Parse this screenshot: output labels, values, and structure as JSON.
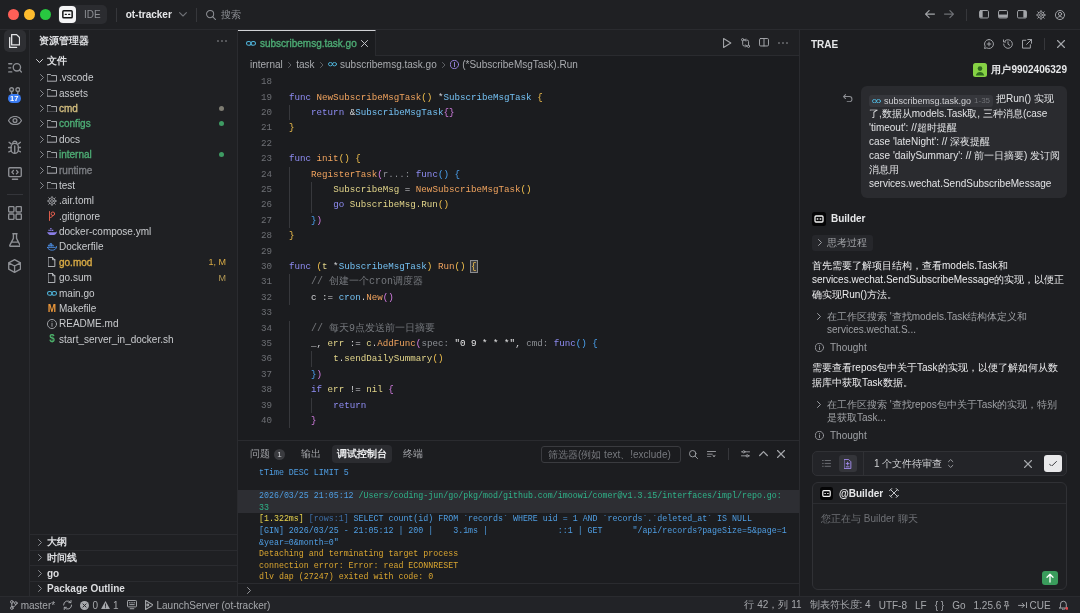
{
  "title_bar": {
    "mode_switch": [
      {
        "kind": "logo",
        "selected": true
      },
      {
        "kind": "label",
        "label": "IDE",
        "selected": false
      }
    ],
    "project": "ot-tracker",
    "search": {
      "placeholder": "搜索"
    }
  },
  "activity_bar": {
    "groups": [
      {
        "items": [
          {
            "kind": "explorer",
            "selected": true
          },
          {
            "kind": "search",
            "selected": false
          },
          {
            "kind": "source_control",
            "selected": false,
            "badge": "17"
          },
          {
            "kind": "preview",
            "selected": false
          },
          {
            "kind": "debug",
            "selected": false
          },
          {
            "kind": "remote",
            "selected": false
          }
        ]
      },
      {
        "items": [
          {
            "kind": "extensions",
            "selected": false
          },
          {
            "kind": "testing",
            "selected": false
          },
          {
            "kind": "packages",
            "selected": false
          }
        ]
      }
    ]
  },
  "sidebar": {
    "title": "资源管理器",
    "section": {
      "label": "文件",
      "expanded": true,
      "items": [
        {
          "label": ".vscode",
          "kind": "folder",
          "expanded": false
        },
        {
          "label": "assets",
          "kind": "folder",
          "expanded": false
        },
        {
          "label": "cmd",
          "kind": "folder",
          "expanded": false,
          "color": "#d2bd7e",
          "dot": {
            "color": "#7e7c72"
          }
        },
        {
          "label": "configs",
          "kind": "folder",
          "expanded": false,
          "color": "#4dab74",
          "dot": {
            "color": "#3e9b63"
          }
        },
        {
          "label": "docs",
          "kind": "folder",
          "expanded": false
        },
        {
          "label": "internal",
          "kind": "folder",
          "expanded": false,
          "color": "#4dab74",
          "dot": {
            "color": "#3e9b63"
          }
        },
        {
          "label": "runtime",
          "kind": "folder",
          "expanded": false,
          "color": "#7c7e83"
        },
        {
          "label": "test",
          "kind": "folder",
          "expanded": false
        },
        {
          "label": ".air.toml",
          "kind": "toml"
        },
        {
          "label": ".gitignore",
          "kind": "gitignore"
        },
        {
          "label": "docker-compose.yml",
          "kind": "compose"
        },
        {
          "label": "Dockerfile",
          "kind": "dockerfile"
        },
        {
          "label": "go.mod",
          "kind": "text",
          "color": "#d9ab45",
          "badge": "1, M"
        },
        {
          "label": "go.sum",
          "kind": "text",
          "badge": "M"
        },
        {
          "label": "main.go",
          "kind": "go"
        },
        {
          "label": "Makefile",
          "kind": "makefile",
          "glyph": "M"
        },
        {
          "label": "README.md",
          "kind": "markdown"
        },
        {
          "label": "start_server_in_docker.sh",
          "kind": "shell",
          "glyph": "$"
        }
      ]
    },
    "panels": [
      {
        "label": "大纲",
        "expanded": false
      },
      {
        "label": "时间线",
        "expanded": false
      },
      {
        "label": "go",
        "expanded": false
      },
      {
        "label": "Package Outline",
        "expanded": false
      }
    ]
  },
  "editor": {
    "tabs": [
      {
        "label": "subscribemsg.task.go",
        "selected": true,
        "color": "#4dab74"
      }
    ],
    "breadcrumb": [
      {
        "label": "internal",
        "kind": "folder"
      },
      {
        "label": "task",
        "kind": "folder"
      },
      {
        "label": "subscribemsg.task.go",
        "kind": "go"
      },
      {
        "label": "(*SubscribeMsgTask).Run",
        "kind": "method"
      }
    ],
    "lines": [
      {
        "number": "18"
      },
      {
        "number": "19",
        "tokens": [
          {
            "text": "func",
            "kind": "keyword"
          },
          {
            "text": " NewSubscribeMsgTask",
            "kind": "function"
          },
          {
            "text": "()",
            "kind": "bracket1"
          },
          {
            "text": " *",
            "kind": "plain"
          },
          {
            "text": "SubscribeMsgTask",
            "kind": "type"
          },
          {
            "text": " {",
            "kind": "bracket1"
          }
        ]
      },
      {
        "number": "20",
        "tokens": [
          {
            "text": "    return",
            "kind": "keyword"
          },
          {
            "text": " &",
            "kind": "plain"
          },
          {
            "text": "SubscribeMsgTask",
            "kind": "type"
          },
          {
            "text": "{}",
            "kind": "bracket2"
          }
        ]
      },
      {
        "number": "21",
        "tokens": [
          {
            "text": "}",
            "kind": "bracket1"
          }
        ]
      },
      {
        "number": "22"
      },
      {
        "number": "23",
        "tokens": [
          {
            "text": "func",
            "kind": "keyword"
          },
          {
            "text": " init",
            "kind": "function"
          },
          {
            "text": "()",
            "kind": "bracket1"
          },
          {
            "text": " {",
            "kind": "bracket1"
          }
        ]
      },
      {
        "number": "24",
        "tokens": [
          {
            "text": "    RegisterTask",
            "kind": "function"
          },
          {
            "text": "(",
            "kind": "bracket2"
          },
          {
            "text": "r...:",
            "kind": "hint"
          },
          {
            "text": " func",
            "kind": "keyword"
          },
          {
            "text": "()",
            "kind": "bracket3"
          },
          {
            "text": " {",
            "kind": "bracket3"
          }
        ]
      },
      {
        "number": "25",
        "tokens": [
          {
            "text": "        SubscribeMsg",
            "kind": "variable"
          },
          {
            "text": " = ",
            "kind": "plain"
          },
          {
            "text": "NewSubscribeMsgTask",
            "kind": "function"
          },
          {
            "text": "()",
            "kind": "bracket1"
          }
        ]
      },
      {
        "number": "26",
        "tokens": [
          {
            "text": "        go",
            "kind": "keyword"
          },
          {
            "text": " SubscribeMsg.Run",
            "kind": "variable"
          },
          {
            "text": "()",
            "kind": "bracket1"
          }
        ]
      },
      {
        "number": "27",
        "tokens": [
          {
            "text": "    }",
            "kind": "bracket3"
          },
          {
            "text": ")",
            "kind": "bracket2"
          }
        ]
      },
      {
        "number": "28",
        "tokens": [
          {
            "text": "}",
            "kind": "bracket1"
          }
        ]
      },
      {
        "number": "29"
      },
      {
        "number": "30",
        "tokens": [
          {
            "text": "func",
            "kind": "keyword"
          },
          {
            "text": " (",
            "kind": "bracket1"
          },
          {
            "text": "t",
            "kind": "variable"
          },
          {
            "text": " *",
            "kind": "plain"
          },
          {
            "text": "SubscribeMsgTask",
            "kind": "type"
          },
          {
            "text": ")",
            "kind": "bracket1"
          },
          {
            "text": " Run",
            "kind": "function"
          },
          {
            "text": "() ",
            "kind": "bracket1"
          },
          {
            "text": "{",
            "kind": "match"
          }
        ]
      },
      {
        "number": "31",
        "tokens": [
          {
            "text": "    // 创建一个cron调度器",
            "kind": "comment"
          }
        ]
      },
      {
        "number": "32",
        "tokens": [
          {
            "text": "    c",
            "kind": "plain"
          },
          {
            "text": " := ",
            "kind": "plain"
          },
          {
            "text": "cron",
            "kind": "type"
          },
          {
            "text": ".",
            "kind": "plain"
          },
          {
            "text": "New",
            "kind": "function"
          },
          {
            "text": "()",
            "kind": "bracket2"
          }
        ]
      },
      {
        "number": "33"
      },
      {
        "number": "34",
        "tokens": [
          {
            "text": "    // 每天9点发送前一日摘要",
            "kind": "comment"
          }
        ]
      },
      {
        "number": "35",
        "tokens": [
          {
            "text": "    _, ",
            "kind": "plain"
          },
          {
            "text": "err",
            "kind": "variable"
          },
          {
            "text": " := ",
            "kind": "plain"
          },
          {
            "text": "c",
            "kind": "variable"
          },
          {
            "text": ".",
            "kind": "plain"
          },
          {
            "text": "AddFunc",
            "kind": "function"
          },
          {
            "text": "(",
            "kind": "bracket2"
          },
          {
            "text": "spec:",
            "kind": "hint"
          },
          {
            "text": " \"0 9 * * *\"",
            "kind": "string"
          },
          {
            "text": ", ",
            "kind": "plain"
          },
          {
            "text": "cmd:",
            "kind": "hint"
          },
          {
            "text": " func",
            "kind": "keyword"
          },
          {
            "text": "()",
            "kind": "bracket3"
          },
          {
            "text": " {",
            "kind": "bracket3"
          }
        ]
      },
      {
        "number": "36",
        "tokens": [
          {
            "text": "        t",
            "kind": "variable"
          },
          {
            "text": ".",
            "kind": "plain"
          },
          {
            "text": "sendDailySummary",
            "kind": "variable"
          },
          {
            "text": "()",
            "kind": "bracket1"
          }
        ]
      },
      {
        "number": "37",
        "tokens": [
          {
            "text": "    }",
            "kind": "bracket3"
          },
          {
            "text": ")",
            "kind": "bracket2"
          }
        ]
      },
      {
        "number": "38",
        "tokens": [
          {
            "text": "    if",
            "kind": "keyword"
          },
          {
            "text": " err",
            "kind": "variable"
          },
          {
            "text": " != ",
            "kind": "plain"
          },
          {
            "text": "nil",
            "kind": "variable"
          },
          {
            "text": " {",
            "kind": "bracket2"
          }
        ]
      },
      {
        "number": "39",
        "tokens": [
          {
            "text": "        return",
            "kind": "keyword"
          }
        ]
      },
      {
        "number": "40",
        "tokens": [
          {
            "text": "    }",
            "kind": "bracket2"
          }
        ]
      }
    ]
  },
  "panel": {
    "tabs": [
      {
        "label": "问题",
        "count": "1",
        "selected": false
      },
      {
        "label": "输出",
        "selected": false
      },
      {
        "label": "调试控制台",
        "selected": true
      },
      {
        "label": "终端",
        "selected": false
      }
    ],
    "filter": {
      "placeholder": "筛选器(例如 text、!exclude)"
    },
    "output": [
      {
        "highlighted": false,
        "segments": [
          {
            "text": "tTime DESC LIMIT 5",
            "kind": "info"
          }
        ]
      },
      {
        "highlighted": false
      },
      {
        "highlighted": true,
        "segments": [
          {
            "text": "2026/03/25 21:05:12 ",
            "kind": "info"
          },
          {
            "text": "/Users/coding-jun/go/pkg/mod/github.com/imoowi/comer@v1.3.15/interfaces/impl/repo.go:",
            "kind": "path"
          }
        ]
      },
      {
        "highlighted": true,
        "segments": [
          {
            "text": "33",
            "kind": "path"
          }
        ]
      },
      {
        "highlighted": false,
        "segments": [
          {
            "text": "[1.322ms]",
            "kind": "duration"
          },
          {
            "text": " [rows:1]",
            "kind": "rows"
          },
          {
            "text": " SELECT count(id) FROM `records` WHERE uid = 1 AND `records`.`deleted_at` IS NULL",
            "kind": "info"
          }
        ]
      },
      {
        "highlighted": false,
        "segments": [
          {
            "text": "[GIN] 2026/03/25 - 21:05:12 | 200 |    3.1ms |              ::1 | GET      \"/api/records?pageSize=5&page=1",
            "kind": "info"
          }
        ]
      },
      {
        "highlighted": false,
        "segments": [
          {
            "text": "&year=0&month=0\"",
            "kind": "info"
          }
        ]
      },
      {
        "highlighted": false,
        "segments": [
          {
            "text": "Detaching and terminating target process",
            "kind": "warn"
          }
        ]
      },
      {
        "highlighted": false,
        "segments": [
          {
            "text": "connection error: Error: read ECONNRESET",
            "kind": "warn"
          }
        ]
      },
      {
        "highlighted": false,
        "segments": [
          {
            "text": "dlv dap (27247) exited with code: 0",
            "kind": "warn"
          }
        ]
      }
    ]
  },
  "chat": {
    "title": "TRAE",
    "user": {
      "name": "用户9902406329"
    },
    "message": {
      "file": "subscribemsg.task.go",
      "range": "1-35",
      "text": "把Run() 实现了,数据从models.Task取, 三种消息(case 'timeout': //超时提醒\ncase 'lateNight': // 深夜提醒\ncase 'dailySummary': // 前一日摘要) 发订阅消息用 services.wechat.SendSubscribeMessage"
    },
    "assistant": {
      "name": "Builder"
    },
    "steps": [
      {
        "kind": "thinking",
        "label": "思考过程",
        "expanded": false
      },
      {
        "kind": "text",
        "text": "首先需要了解项目结构，查看models.Task和services.wechat.SendSubscribeMessage的实现，以便正确实现Run()方法。"
      },
      {
        "kind": "search",
        "text": "在工作区搜索 '查找models.Task结构体定义和services.wechat.S...",
        "expanded": false
      },
      {
        "kind": "thought",
        "text": "Thought"
      },
      {
        "kind": "text",
        "text": "需要查看repos包中关于Task的实现，以便了解如何从数据库中获取Task数据。"
      },
      {
        "kind": "search",
        "text": "在工作区搜索 '查找repos包中关于Task的实现，特别是获取Task...",
        "expanded": false
      },
      {
        "kind": "thought",
        "text": "Thought"
      }
    ],
    "review": {
      "views": [
        {
          "kind": "list",
          "selected": false
        },
        {
          "kind": "file",
          "selected": true
        }
      ],
      "label": "1 个文件待审查"
    },
    "composer": {
      "agent": "@Builder",
      "placeholder": "您正在与 Builder 聊天"
    }
  },
  "status_bar": {
    "left": [
      {
        "kind": "branch",
        "label": "master*"
      },
      {
        "kind": "sync"
      },
      {
        "kind": "problems",
        "errors": "0",
        "warnings": "1"
      },
      {
        "kind": "ports"
      },
      {
        "kind": "launch",
        "label": "LaunchServer (ot-tracker)"
      }
    ],
    "right": [
      {
        "kind": "text",
        "label": "行 42，列 11"
      },
      {
        "kind": "text",
        "label": "制表符长度: 4"
      },
      {
        "kind": "text",
        "label": "UTF-8"
      },
      {
        "kind": "text",
        "label": "LF"
      },
      {
        "kind": "language_status",
        "label": "{ }"
      },
      {
        "kind": "text",
        "label": "Go"
      },
      {
        "kind": "version",
        "label": "1.25.6"
      },
      {
        "kind": "extension",
        "label": "CUE"
      },
      {
        "kind": "notifications"
      }
    ]
  }
}
